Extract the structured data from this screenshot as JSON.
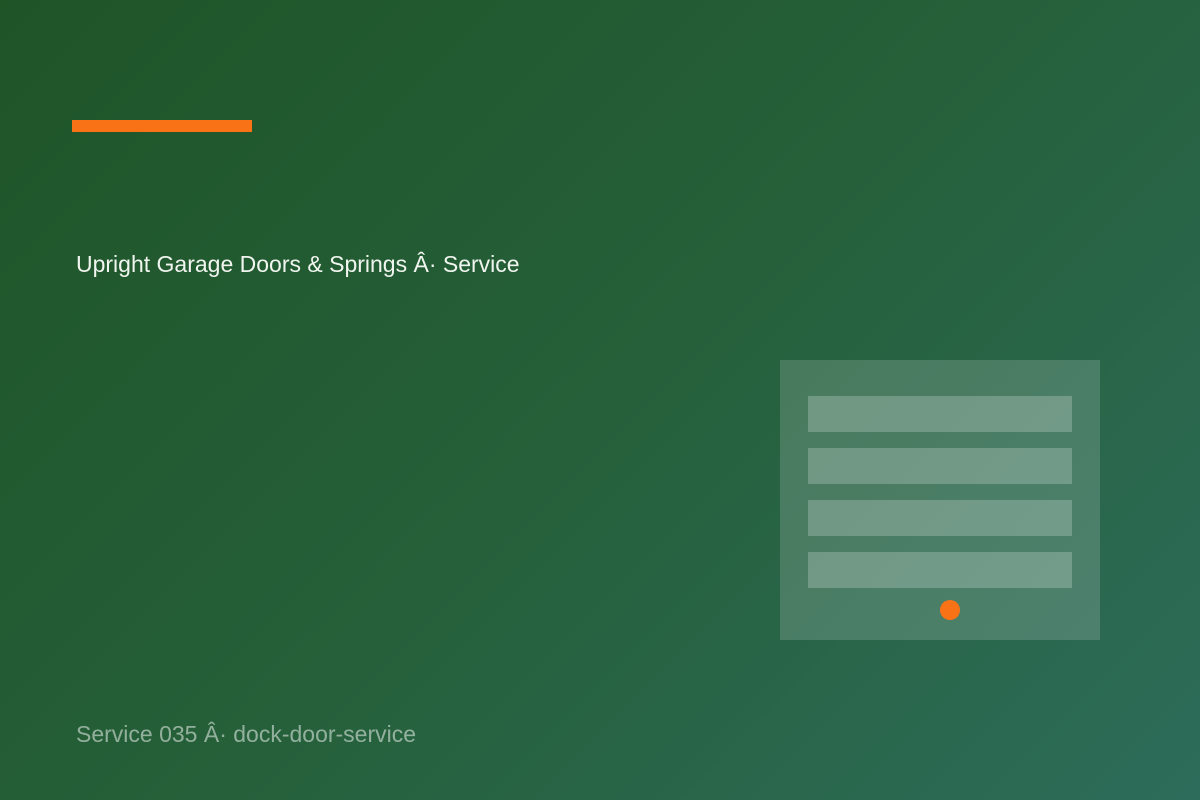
{
  "title": "Upright Garage Doors & Springs Â· Service",
  "footer": "Service 035 Â· dock-door-service",
  "colors": {
    "accent": "#f97316",
    "background_start": "#1f5427",
    "background_end": "#2d6c5a"
  },
  "illustration": {
    "icon": "garage-door-icon",
    "panel_count": 4
  }
}
